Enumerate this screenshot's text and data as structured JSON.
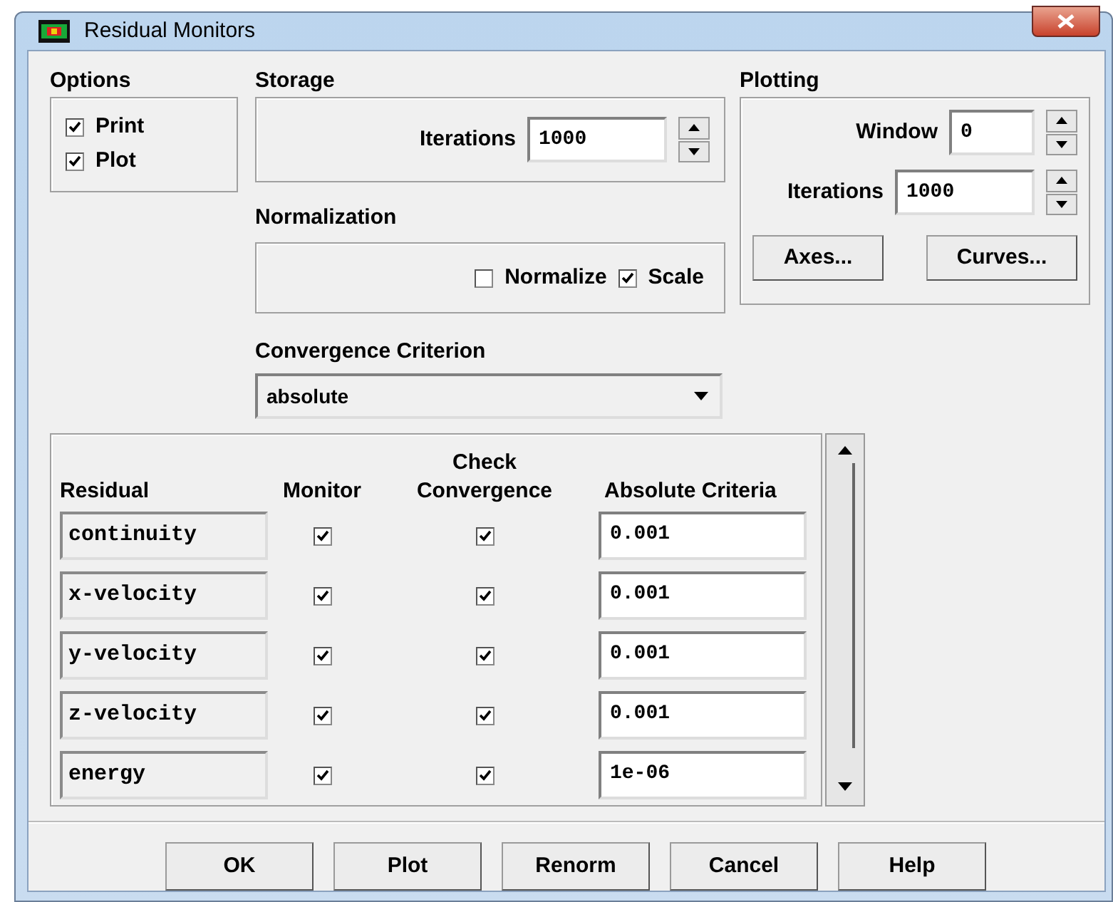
{
  "window": {
    "title": "Residual Monitors"
  },
  "options": {
    "title": "Options",
    "items": [
      {
        "label": "Print",
        "checked": true
      },
      {
        "label": "Plot",
        "checked": true
      }
    ]
  },
  "storage": {
    "title": "Storage",
    "iterations_label": "Iterations",
    "iterations_value": "1000"
  },
  "plotting": {
    "title": "Plotting",
    "window_label": "Window",
    "window_value": "0",
    "iterations_label": "Iterations",
    "iterations_value": "1000",
    "buttons": [
      "Axes...",
      "Curves..."
    ]
  },
  "normalization": {
    "title": "Normalization",
    "items": [
      {
        "label": "Normalize",
        "checked": false
      },
      {
        "label": "Scale",
        "checked": true
      }
    ]
  },
  "convergence": {
    "label": "Convergence Criterion",
    "value": "absolute"
  },
  "table": {
    "columns": [
      "Residual",
      "Monitor",
      "Check Convergence",
      "Absolute Criteria"
    ],
    "rows": [
      {
        "residual": "continuity",
        "monitor": true,
        "check_convergence": true,
        "criteria": "0.001"
      },
      {
        "residual": "x-velocity",
        "monitor": true,
        "check_convergence": true,
        "criteria": "0.001"
      },
      {
        "residual": "y-velocity",
        "monitor": true,
        "check_convergence": true,
        "criteria": "0.001"
      },
      {
        "residual": "z-velocity",
        "monitor": true,
        "check_convergence": true,
        "criteria": "0.001"
      },
      {
        "residual": "energy",
        "monitor": true,
        "check_convergence": true,
        "criteria": "1e-06"
      }
    ]
  },
  "buttons": [
    "OK",
    "Plot",
    "Renorm",
    "Cancel",
    "Help"
  ]
}
